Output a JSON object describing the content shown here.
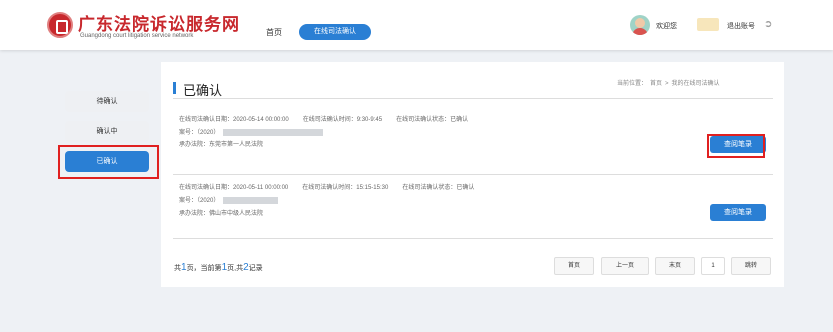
{
  "header": {
    "title": "广东法院诉讼服务网",
    "subtitle": "Guangdong court litigation service network",
    "nav_home": "首页",
    "nav_active": "在线司法确认",
    "welcome": "欢迎您",
    "logout": "退出账号"
  },
  "sidebar": {
    "items": [
      {
        "label": "待确认"
      },
      {
        "label": "确认中"
      },
      {
        "label": "已确认"
      }
    ]
  },
  "main": {
    "title": "已确认",
    "breadcrumb": [
      "当前位置：",
      "首页",
      ">",
      "我的在线司法确认"
    ],
    "records": [
      {
        "apply_date": "在线司法确认日期：2020-05-14 00:00:00",
        "confirm_time": "在线司法确认时间：9:30-9:45",
        "status": "在线司法确认状态：已确认",
        "case_no": "案号：（2020）",
        "court": "承办法院：东莞市第一人民法院",
        "button": "查阅笔录"
      },
      {
        "apply_date": "在线司法确认日期：2020-05-11 00:00:00",
        "confirm_time": "在线司法确认时间：15:15-15:30",
        "status": "在线司法确认状态：已确认",
        "case_no": "案号：（2020）",
        "court": "承办法院：佛山市中级人民法院",
        "button": "查阅笔录"
      }
    ]
  },
  "pager": {
    "prefix": "共",
    "total_pages": "1",
    "mid1": "页，当前第",
    "current_page": "1",
    "mid2": "页,共",
    "total_records": "2",
    "suffix": "记录",
    "first": "首页",
    "prev": "上一页",
    "last": "末页",
    "page_input": "1",
    "jump": "跳转"
  },
  "colors": {
    "brand_red": "#c8282d",
    "accent_blue": "#2a7fd4",
    "highlight_red": "#e02020"
  }
}
